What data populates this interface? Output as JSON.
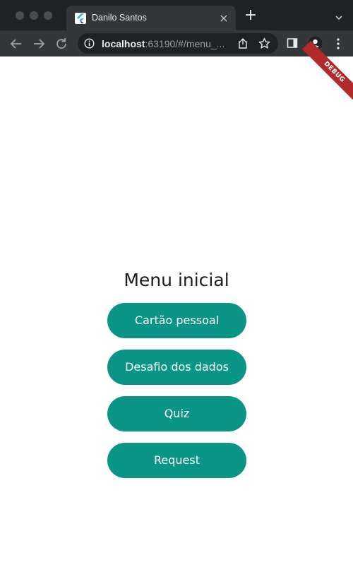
{
  "browser": {
    "tab": {
      "title": "Danilo Santos",
      "close_glyph": "×",
      "favicon": "flutter-icon"
    },
    "new_tab_glyph": "+",
    "address": {
      "host": "localhost",
      "rest": ":63190/#/menu_...",
      "full": "localhost:63190/#/menu_..."
    }
  },
  "app": {
    "debug_banner": "DEBUG",
    "title": "Menu inicial",
    "buttons": [
      {
        "label": "Cartão pessoal"
      },
      {
        "label": "Desafio dos dados"
      },
      {
        "label": "Quiz"
      },
      {
        "label": "Request"
      }
    ],
    "colors": {
      "button_bg": "#0b9586",
      "button_text": "#ffffff",
      "debug_banner": "#b12a2a",
      "browser_frame": "#202124",
      "browser_toolbar": "#35363a"
    }
  }
}
